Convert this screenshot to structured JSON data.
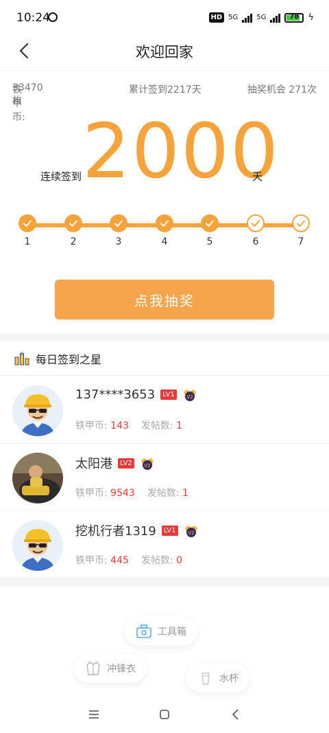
{
  "status": {
    "time": "10:24",
    "hd": "HD",
    "net1": "5G",
    "net2": "5G",
    "battery": "78",
    "battery_level": 0.78
  },
  "header": {
    "title": "欢迎回家"
  },
  "stats": {
    "coins_label": "铁甲币:",
    "coins_value": "33470枚",
    "total_signin": "累计签到2217天",
    "lottery": "抽奖机会 271次"
  },
  "streak": {
    "label": "连续签到",
    "number": "2000",
    "unit": "天"
  },
  "days": [
    {
      "num": "1",
      "done": true
    },
    {
      "num": "2",
      "done": true
    },
    {
      "num": "3",
      "done": true
    },
    {
      "num": "4",
      "done": true
    },
    {
      "num": "5",
      "done": true
    },
    {
      "num": "6",
      "done": false
    },
    {
      "num": "7",
      "done": false
    }
  ],
  "draw_button": "点我抽奖",
  "stars_section": {
    "title": "每日签到之星"
  },
  "stars": [
    {
      "name": "137****3653",
      "level": "LV1",
      "vip": "V2",
      "coins_label": "铁甲币:",
      "coins": "143",
      "posts_label": "发帖数:",
      "posts": "1",
      "avatar": "worker"
    },
    {
      "name": "太阳港",
      "level": "LV2",
      "vip": "V2",
      "coins_label": "铁甲币:",
      "coins": "9543",
      "posts_label": "发帖数:",
      "posts": "1",
      "avatar": "photo"
    },
    {
      "name": "挖机行者1319",
      "level": "LV1",
      "vip": "V2",
      "coins_label": "铁甲币:",
      "coins": "445",
      "posts_label": "发帖数:",
      "posts": "0",
      "avatar": "worker"
    }
  ],
  "tags": {
    "toolbox": "工具箱",
    "jacket": "冲锋衣",
    "cup": "水杯"
  },
  "colors": {
    "accent": "#f6a33c",
    "button": "#f6a54c",
    "red": "#e23b3b"
  }
}
